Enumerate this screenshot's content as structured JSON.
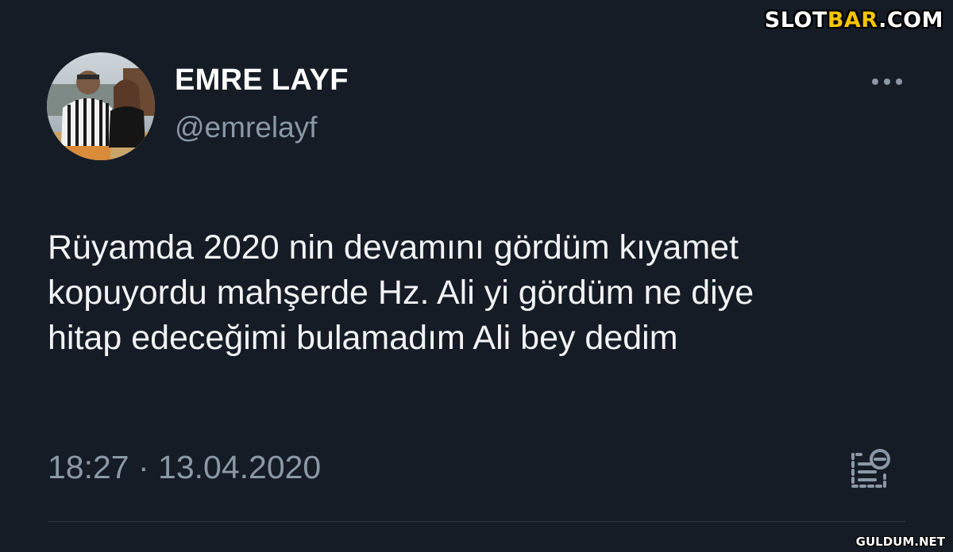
{
  "tweet": {
    "author": {
      "display_name": "EMRE LAYF",
      "handle": "@emrelayf",
      "avatar_icon": "profile-photo"
    },
    "text_lines": [
      "Rüyamda 2020 nin devamını gördüm kıyamet",
      "kopuyordu mahşerde Hz. Ali yi gördüm ne diye",
      "hitap edeceğimi bulamadım Ali bey dedim"
    ],
    "timestamp": "18:27 · 13.04.2020",
    "more_icon": "ellipsis-icon",
    "analytics_icon": "view-analytics-icon"
  },
  "watermarks": {
    "top_right": {
      "part1": "SLOT",
      "part2": "BAR",
      "part3": ".COM",
      "accent_color": "#f5c400"
    },
    "bottom_right": "GULDUM.NET"
  },
  "colors": {
    "background": "#151c26",
    "primary_text": "#f1f3f5",
    "secondary_text": "#8b98a5"
  }
}
